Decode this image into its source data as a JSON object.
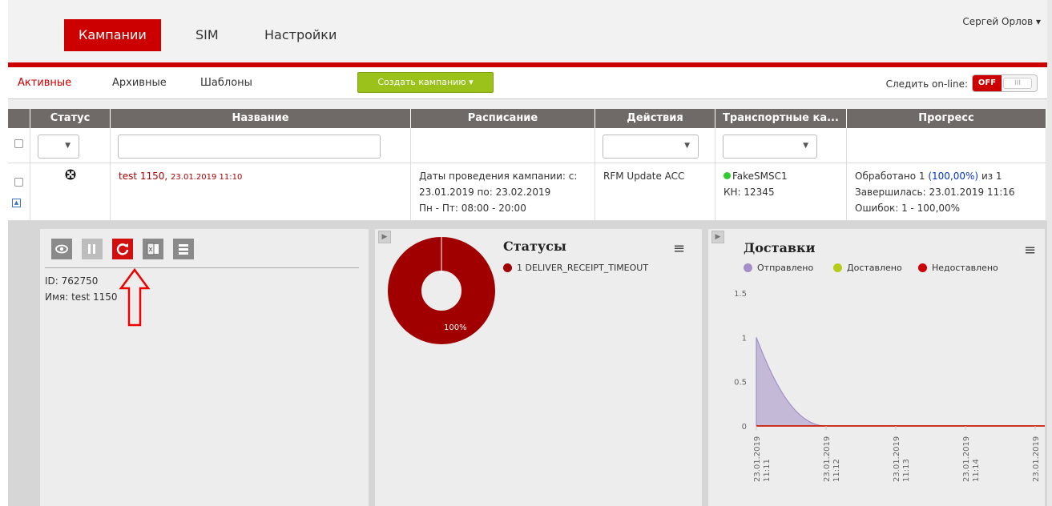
{
  "nav": {
    "items": [
      "Кампании",
      "SIM",
      "Настройки"
    ],
    "user": "Сергей Орлов ▾"
  },
  "subnav": {
    "tabs": [
      "Активные",
      "Архивные",
      "Шаблоны"
    ],
    "create_button": "Создать кампанию ▾",
    "follow_label": "Следить on-line:",
    "toggle_off": "OFF",
    "toggle_grip": "III"
  },
  "table": {
    "headers": [
      "Статус",
      "Название",
      "Расписание",
      "Действия",
      "Транспортные ка...",
      "Прогресс"
    ],
    "row": {
      "name": "test 1150,",
      "name_date": "23.01.2019 11:10",
      "schedule": [
        "Даты проведения кампании: с:",
        "23.01.2019 по: 23.02.2019",
        "Пн - Пт: 08:00 - 20:00"
      ],
      "action": "RFM Update ACC",
      "transport_name": "FakeSMSC1",
      "transport_kn": "КН: 12345",
      "progress_prefix": "Обработано 1 ",
      "progress_pct": "(100,00%)",
      "progress_suffix": " из 1",
      "progress_done": "Завершилась: 23.01.2019 11:16",
      "progress_errors": "Ошибок: 1 - 100,00%"
    }
  },
  "detail": {
    "id_line": "ID: 762750",
    "name_line": "Имя: test 1150",
    "tools": [
      "eye-icon",
      "pause-icon",
      "refresh-icon",
      "excel-icon",
      "list-icon"
    ]
  },
  "statuses_chart": {
    "title": "Статусы",
    "legend": "1 DELIVER_RECEIPT_TIMEOUT",
    "slice_label": "100%",
    "color": "#a00000"
  },
  "chart_data": {
    "type": "area",
    "title": "Доставки",
    "x": [
      "23.01.2019 11:11",
      "23.01.2019 11:12",
      "23.01.2019 11:13",
      "23.01.2019 11:14",
      "23.01.2019"
    ],
    "yticks": [
      "1.5",
      "1",
      "0.5",
      "0"
    ],
    "ylim": [
      0,
      1.5
    ],
    "series": [
      {
        "name": "Отправлено",
        "color": "#a48ec7",
        "values": [
          1,
          0,
          0,
          0,
          0
        ]
      },
      {
        "name": "Доставлено",
        "color": "#b5cc18",
        "values": [
          0,
          0,
          0,
          0,
          0
        ]
      },
      {
        "name": "Недоставлено",
        "color": "#cc0000",
        "values": [
          0,
          0,
          0,
          0,
          0
        ]
      }
    ]
  }
}
